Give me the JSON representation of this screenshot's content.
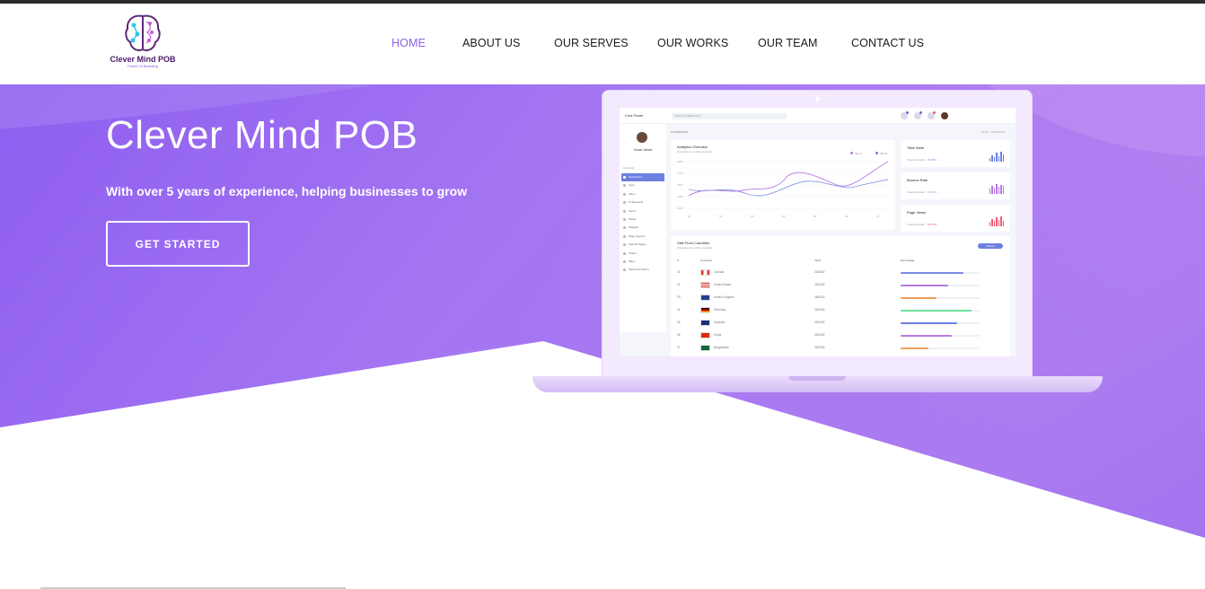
{
  "nav": {
    "logo_title": "Clever Mind POB",
    "logo_tagline": "Power Of Branding",
    "items": [
      {
        "label": "HOME",
        "active": true
      },
      {
        "label": "ABOUT US",
        "active": false
      },
      {
        "label": "OUR SERVES",
        "active": false
      },
      {
        "label": "OUR WORKS",
        "active": false
      },
      {
        "label": "OUR TEAM",
        "active": false
      },
      {
        "label": "CONTACT US",
        "active": false
      }
    ]
  },
  "hero": {
    "title": "Clever Mind POB",
    "subtitle": "With over 5 years of experience, helping businesses to grow",
    "cta_label": "GET STARTED",
    "gradient_colors": [
      "#8e5ef0",
      "#b98af2"
    ]
  },
  "mockup": {
    "brand": "Cool Power",
    "search_placeholder": "Search Dashboard",
    "user_name": "Yonas James",
    "section_label": "Personal",
    "menu": [
      "Dashboard",
      "Apps",
      "Inbox",
      "Ui Elements",
      "Forms",
      "Tables",
      "Widgets",
      "Page Layouts",
      "Sample Pages",
      "Charts",
      "Maps",
      "Multi Level Menu"
    ],
    "breadcrumb": "DASHBOARD",
    "breadcrumb_right": "Home > Dashboard",
    "analytics": {
      "title": "Analytics Overview",
      "subtitle": "Overview of monthly analytics",
      "legend": [
        "Site A",
        "Site B"
      ],
      "y_ticks": [
        "2000",
        "1750",
        "1500",
        "1250",
        "1000"
      ],
      "x_ticks": [
        "01",
        "02",
        "03",
        "04",
        "05",
        "06",
        "07"
      ]
    },
    "stats": [
      {
        "title": "Total Visits",
        "label": "Overall Growth",
        "value": "35.65%",
        "color": "#6d7fe0"
      },
      {
        "title": "Bounce Rate",
        "label": "Overall Growth",
        "value": "15.65%",
        "color": "#b57be0"
      },
      {
        "title": "Page Views",
        "label": "Overall Growth",
        "value": "25.65%",
        "color": "#f05b7a"
      }
    ],
    "countries": {
      "title": "Visit From Countries",
      "subtitle": "Overview of monthly analytics",
      "export_label": "Actions",
      "headers": [
        "#",
        "Countries",
        "Visits",
        "Percentage"
      ],
      "rows": [
        {
          "num": "01",
          "name": "Canada",
          "visits": "345/332",
          "pct": 0.8,
          "color": "#7a8ae8"
        },
        {
          "num": "02",
          "name": "United States",
          "visits": "345/332",
          "pct": 0.6,
          "color": "#b57be0"
        },
        {
          "num": "03",
          "name": "United Kingdom",
          "visits": "345/332",
          "pct": 0.45,
          "color": "#f0a05b"
        },
        {
          "num": "04",
          "name": "Germany",
          "visits": "345/332",
          "pct": 0.9,
          "color": "#6ee0a0"
        },
        {
          "num": "05",
          "name": "Australia",
          "visits": "345/332",
          "pct": 0.72,
          "color": "#6d7fe0"
        },
        {
          "num": "06",
          "name": "China",
          "visits": "345/332",
          "pct": 0.65,
          "color": "#b57be0"
        },
        {
          "num": "07",
          "name": "Bangladesh",
          "visits": "345/332",
          "pct": 0.35,
          "color": "#f0a05b"
        }
      ]
    }
  }
}
